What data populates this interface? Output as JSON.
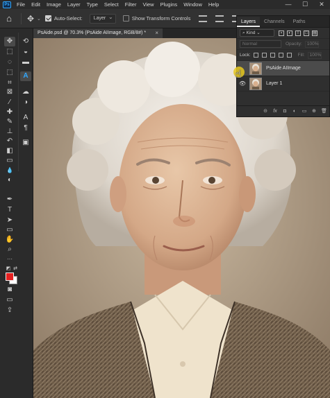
{
  "menubar": {
    "logo": "Ps",
    "items": [
      "File",
      "Edit",
      "Image",
      "Layer",
      "Type",
      "Select",
      "Filter",
      "View",
      "Plugins",
      "Window",
      "Help"
    ],
    "window_controls": [
      "—",
      "☐",
      "✕"
    ]
  },
  "options_bar": {
    "auto_select_label": "Auto-Select:",
    "auto_select_checked": true,
    "target_value": "Layer",
    "transform_label": "Show Transform Controls",
    "transform_checked": false
  },
  "document": {
    "tab_title": "PsAide.psd @ 70.3% (PsAide AIImage, RGB/8#) *",
    "close_symbol": "×"
  },
  "colors": {
    "foreground": "#e52020",
    "background": "#ffffff",
    "accent": "#31a8ff"
  },
  "tools": [
    {
      "name": "move-tool-icon",
      "glyph": "✥"
    },
    {
      "name": "marquee-tool-icon",
      "glyph": "⬚"
    },
    {
      "name": "lasso-tool-icon",
      "glyph": "◌"
    },
    {
      "name": "object-select-tool-icon",
      "glyph": "⬚"
    },
    {
      "name": "crop-tool-icon",
      "glyph": "⌗"
    },
    {
      "name": "frame-tool-icon",
      "glyph": "⊠"
    },
    {
      "name": "eyedropper-tool-icon",
      "glyph": "⁄"
    },
    {
      "name": "healing-brush-tool-icon",
      "glyph": "✚"
    },
    {
      "name": "brush-tool-icon",
      "glyph": "✎"
    },
    {
      "name": "clone-stamp-tool-icon",
      "glyph": "⊥"
    },
    {
      "name": "history-brush-tool-icon",
      "glyph": "↶"
    },
    {
      "name": "eraser-tool-icon",
      "glyph": "◧"
    },
    {
      "name": "gradient-tool-icon",
      "glyph": "▭"
    },
    {
      "name": "blur-tool-icon",
      "glyph": "💧"
    },
    {
      "name": "dodge-tool-icon",
      "glyph": "◐"
    },
    {
      "name": "pen-tool-icon",
      "glyph": "✒"
    },
    {
      "name": "type-tool-icon",
      "glyph": "T"
    },
    {
      "name": "path-select-tool-icon",
      "glyph": "➤"
    },
    {
      "name": "rectangle-tool-icon",
      "glyph": "▭"
    },
    {
      "name": "hand-tool-icon",
      "glyph": "✋"
    },
    {
      "name": "zoom-tool-icon",
      "glyph": "⌕"
    },
    {
      "name": "more-tools-icon",
      "glyph": "···"
    }
  ],
  "panel_tools": [
    {
      "name": "history-panel-icon",
      "glyph": "⟲"
    },
    {
      "name": "adjustments-panel-icon",
      "glyph": "◒"
    },
    {
      "name": "comments-panel-icon",
      "glyph": "▬"
    },
    {
      "name": "ai-panel-icon",
      "glyph": "A"
    },
    {
      "name": "cloud-panel-icon",
      "glyph": "☁"
    },
    {
      "name": "color-panel-icon",
      "glyph": "◑"
    },
    {
      "name": "character-panel-icon",
      "glyph": "A"
    },
    {
      "name": "paragraph-panel-icon",
      "glyph": "¶"
    },
    {
      "name": "libraries-panel-icon",
      "glyph": "▣"
    }
  ],
  "layers_panel": {
    "tabs": [
      "Layers",
      "Channels",
      "Paths"
    ],
    "active_tab": "Layers",
    "kind_label": "Kind",
    "blend_mode": "Normal",
    "opacity_label": "Opacity:",
    "opacity_value": "100%",
    "lock_label": "Lock:",
    "fill_label": "Fill:",
    "fill_value": "100%",
    "layers": [
      {
        "name": "PsAide AIImage",
        "selected": true
      },
      {
        "name": "Layer 1",
        "selected": false
      }
    ],
    "footer_icons": [
      "link-layers-icon",
      "fx-icon",
      "mask-icon",
      "adjustment-layer-icon",
      "group-icon",
      "new-layer-icon",
      "delete-layer-icon"
    ],
    "footer_glyphs": [
      "⊝",
      "fx",
      "◘",
      "◐",
      "▭",
      "⊕",
      "🗑"
    ]
  }
}
